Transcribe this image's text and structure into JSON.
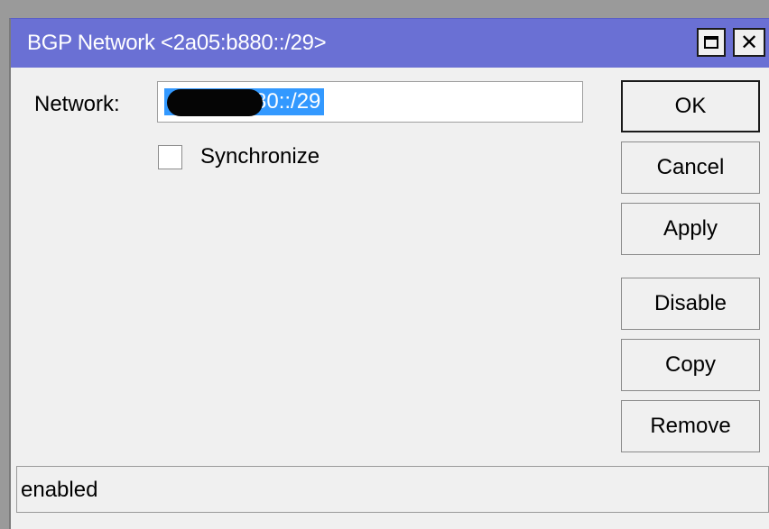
{
  "window": {
    "title": "BGP Network <2a05:b880::/29>"
  },
  "form": {
    "network_label": "Network:",
    "network_value": "80::/29",
    "synchronize_label": "Synchronize",
    "synchronize_checked": false
  },
  "buttons": {
    "ok": "OK",
    "cancel": "Cancel",
    "apply": "Apply",
    "disable": "Disable",
    "copy": "Copy",
    "remove": "Remove"
  },
  "status": {
    "text": "enabled"
  },
  "colors": {
    "titlebar": "#6a70d4",
    "selection": "#3399ff",
    "background": "#f0f0f0"
  }
}
